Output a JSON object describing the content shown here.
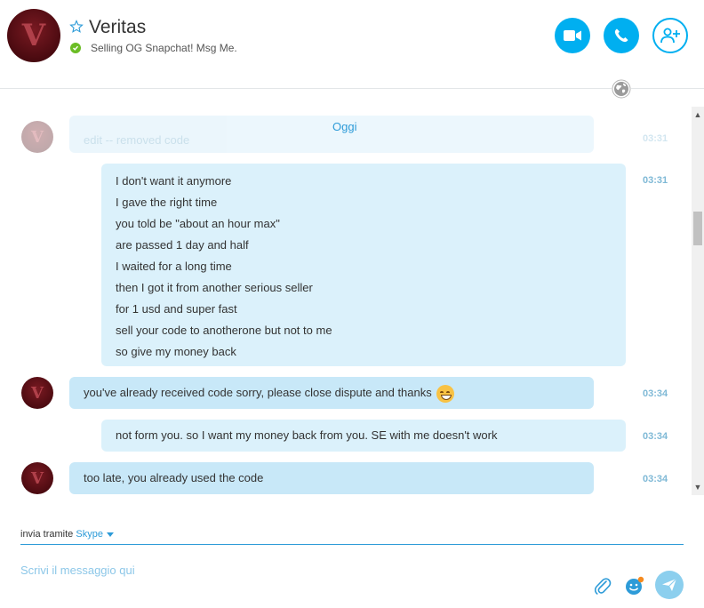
{
  "header": {
    "avatar_letter": "V",
    "contact_name": "Veritas",
    "status_text": "Selling OG Snapchat! Msg Me.",
    "status_color": "#6bbd25",
    "accent_color": "#00aff0",
    "icons": [
      "star-icon",
      "video-call-icon",
      "audio-call-icon",
      "add-contact-icon",
      "globe-icon"
    ]
  },
  "chat": {
    "day_label": "Oggi",
    "faded_message": {
      "text": "edit -- removed code",
      "time": "03:31"
    },
    "messages": [
      {
        "direction": "out",
        "time": "03:31",
        "lines": [
          "I don't want it anymore",
          "I gave the right time",
          "you told be \"about an hour max\"",
          "are passed 1 day and half",
          "I waited for a long time",
          "then I got it from another serious seller",
          "for 1 usd and super fast",
          "sell your code to anotherone but not to me",
          "so give my money back"
        ]
      },
      {
        "direction": "in",
        "time": "03:34",
        "text": "you've already received code sorry, please close dispute and thanks",
        "emoji": "grinning-emoji"
      },
      {
        "direction": "out",
        "time": "03:34",
        "text": "not form you. so I want my money back from you. SE with me doesn't work"
      },
      {
        "direction": "in",
        "time": "03:34",
        "text": "too late, you already used the code"
      }
    ]
  },
  "compose": {
    "via_label": "invia tramite",
    "service": "Skype",
    "placeholder": "Scrivi il messaggio qui",
    "icons": [
      "attach-icon",
      "emoticon-icon",
      "send-icon"
    ]
  }
}
